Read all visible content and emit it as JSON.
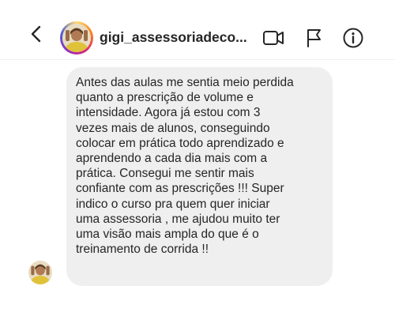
{
  "header": {
    "username": "gigi_assessoriadeco...",
    "icons": {
      "back": "chevron-left-icon",
      "video": "video-camera-icon",
      "report": "flag-icon",
      "info": "info-icon"
    }
  },
  "message": {
    "lines": [
      "Antes das aulas me sentia meio perdida",
      "quanto a prescrição de volume e",
      "intensidade. Agora já estou com 3",
      "vezes mais de alunos, conseguindo",
      "colocar em prática todo aprendizado e",
      "aprendendo a cada dia mais com a",
      "prática. Consegui me sentir mais",
      "confiante com as prescrições !!! Super",
      "indico o curso pra quem quer iniciar",
      "uma assessoria , me ajudou muito ter",
      "uma visão mais ampla do que é o",
      "treinamento de corrida !!"
    ]
  },
  "colors": {
    "bubble": "#efefef",
    "text": "#262626",
    "divider": "#efefef"
  }
}
